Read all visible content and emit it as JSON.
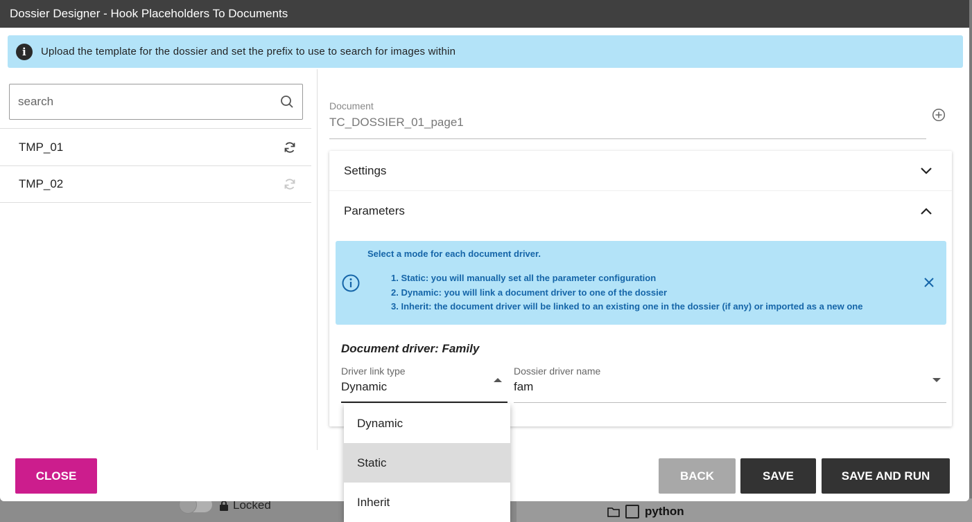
{
  "modal": {
    "title": "Dossier Designer - Hook Placeholders To Documents",
    "banner": "Upload the template for the dossier and set the prefix to use to search for images within"
  },
  "search": {
    "placeholder": "search"
  },
  "templates": [
    {
      "name": "TMP_01",
      "sync_state": "active"
    },
    {
      "name": "TMP_02",
      "sync_state": "disabled"
    }
  ],
  "document": {
    "label": "Document",
    "value": "TC_DOSSIER_01_page1"
  },
  "sections": {
    "settings": "Settings",
    "parameters": "Parameters"
  },
  "param_info": {
    "intro": "Select a mode for each document driver.",
    "lines": [
      "1. Static: you will manually set all the parameter configuration",
      "2. Dynamic: you will link a document driver to one of the dossier",
      "3. Inherit: the document driver will be linked to an existing one in the dossier (if any) or imported as a new one"
    ]
  },
  "driver": {
    "title": "Document driver: Family",
    "link_type_label": "Driver link type",
    "link_type_value": "Dynamic",
    "dossier_name_label": "Dossier driver name",
    "dossier_name_value": "fam"
  },
  "dropdown_options": [
    "Dynamic",
    "Static",
    "Inherit"
  ],
  "buttons": {
    "close": "CLOSE",
    "back": "BACK",
    "save": "SAVE",
    "save_and_run": "SAVE AND RUN"
  },
  "background": {
    "locked_label": "Locked",
    "folder_label": "python"
  },
  "colors": {
    "accent": "#cc1d8d",
    "info_bg": "#b3e3f8",
    "info_text": "#1565a8",
    "header_bg": "#404040"
  }
}
